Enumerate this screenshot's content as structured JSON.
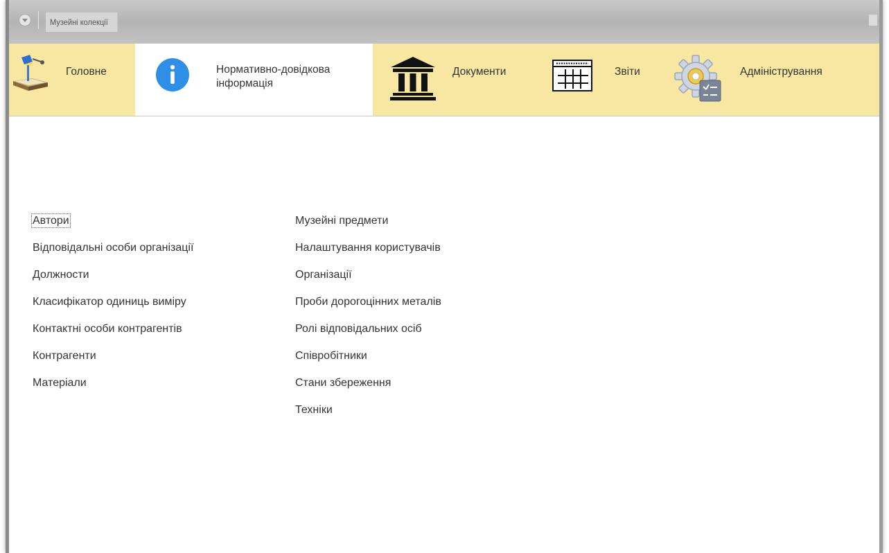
{
  "window": {
    "title": "Музейні колекції"
  },
  "sections": [
    {
      "label": "Головне",
      "icon": "desk-lamp-icon"
    },
    {
      "label": "Нормативно-довідкова\nінформація",
      "icon": "info-icon",
      "active": true
    },
    {
      "label": "Документи",
      "icon": "museum-building-icon"
    },
    {
      "label": "Звіти",
      "icon": "report-table-icon"
    },
    {
      "label": "Адміністрування",
      "icon": "gear-settings-icon"
    }
  ],
  "links": {
    "left": [
      "Автори",
      "Відповідальні особи організації",
      "Должности",
      "Класифікатор одиниць виміру",
      "Контактні особи контрагентів",
      "Контрагенти",
      "Матеріали"
    ],
    "right": [
      "Музейні предмети",
      "Налаштування користувачів",
      "Організації",
      "Проби дорогоцінних металів",
      "Ролі відповідальних осіб",
      "Співробітники",
      "Стани збереження",
      "Техніки"
    ]
  },
  "colors": {
    "section_bar": "#f8e7a2",
    "info_icon": "#2f8ee5",
    "titlebar": "#b8b8b8"
  }
}
